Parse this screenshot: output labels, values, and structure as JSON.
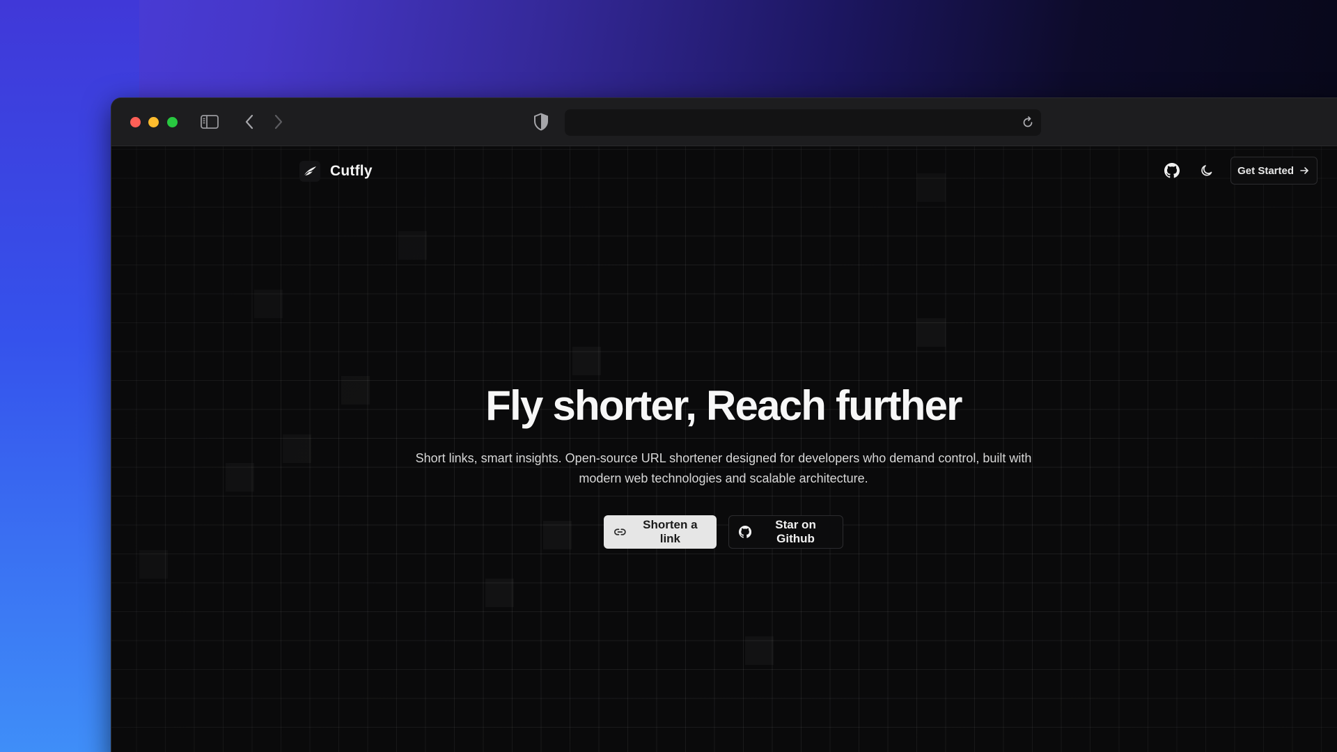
{
  "brand": {
    "name": "Cutfly",
    "logo_icon": "feather-icon"
  },
  "browser": {
    "url": "",
    "icons": [
      "sidebar-toggle-icon",
      "chevron-left-icon",
      "chevron-right-icon",
      "shield-icon",
      "reload-icon"
    ]
  },
  "nav": {
    "github_icon": "github-icon",
    "theme_icon": "moon-icon",
    "get_started_label": "Get Started",
    "get_started_icon": "arrow-right-icon"
  },
  "hero": {
    "title": "Fly shorter, Reach further",
    "subtitle": "Short links, smart insights. Open-source URL shortener designed for developers who demand control, built with modern web technologies and scalable architecture.",
    "primary_cta": "Shorten a link",
    "primary_cta_icon": "link-icon",
    "secondary_cta": "Star on Github",
    "secondary_cta_icon": "github-icon"
  },
  "colors": {
    "page_bg": "#0a0a0b",
    "primary_button_bg": "#e6e6e6",
    "traffic_red": "#ff5f57",
    "traffic_yellow": "#febc2e",
    "traffic_green": "#28c840"
  }
}
